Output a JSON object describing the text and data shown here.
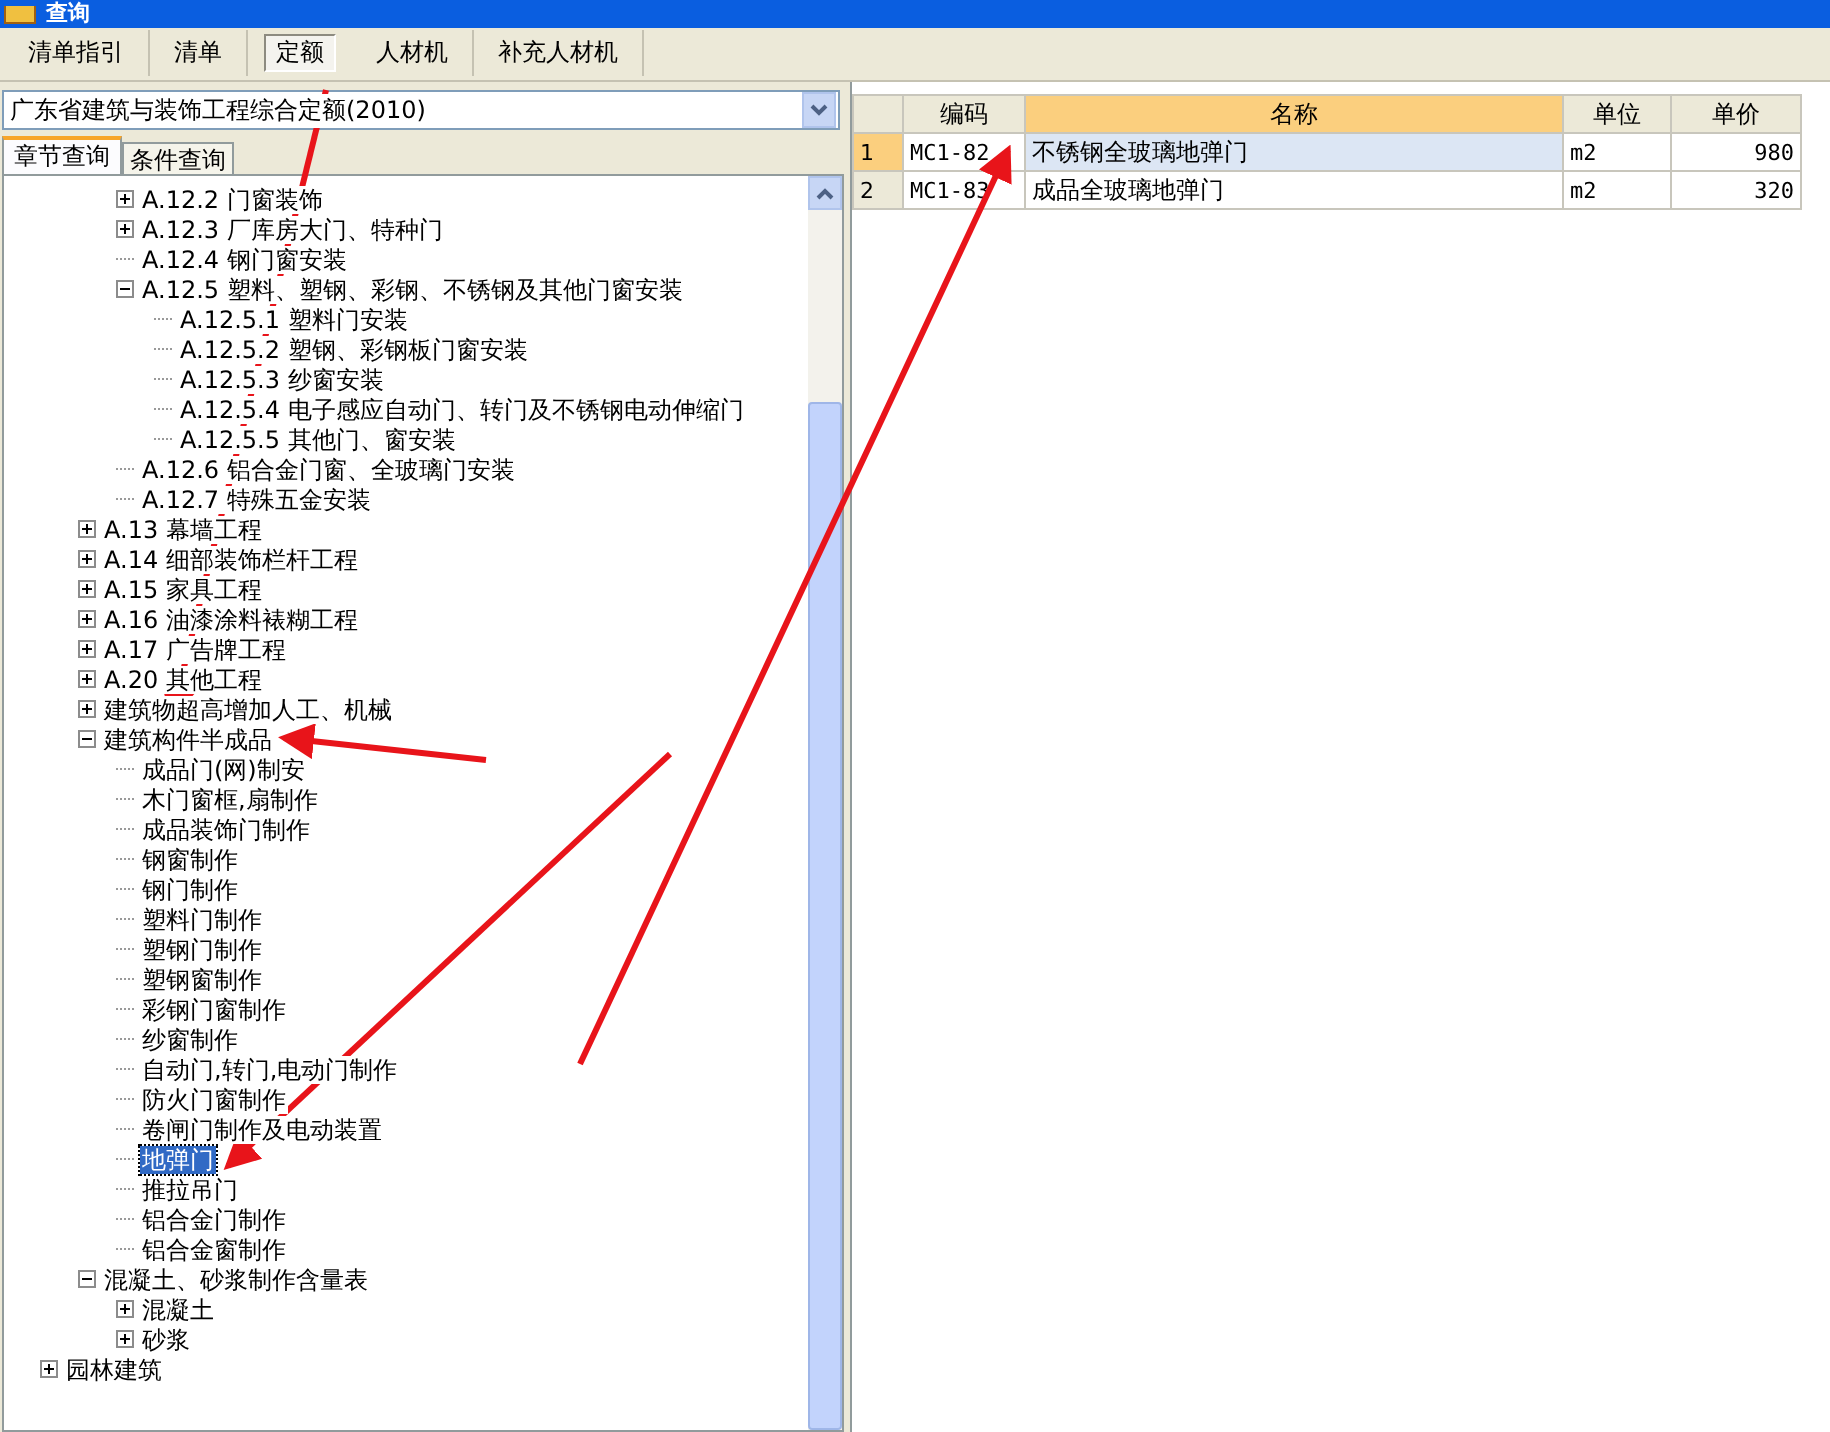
{
  "window": {
    "title": "查询"
  },
  "tabs": [
    {
      "label": "清单指引",
      "selected": false
    },
    {
      "label": "清单",
      "selected": false
    },
    {
      "label": "定额",
      "selected": true
    },
    {
      "label": "人材机",
      "selected": false
    },
    {
      "label": "补充人材机",
      "selected": false
    }
  ],
  "quota_select": {
    "value": "广东省建筑与装饰工程综合定额(2010)"
  },
  "search_tabs": [
    {
      "label": "章节查询",
      "selected": true
    },
    {
      "label": "条件查询",
      "selected": false
    }
  ],
  "tree": {
    "items": [
      {
        "children": [
          {
            "children": [
              {
                "label": "A.12.2 门窗装饰",
                "expanded": false,
                "selected": false
              },
              {
                "label": "A.12.3 厂库房大门、特种门",
                "expanded": false,
                "selected": false
              },
              {
                "label": "A.12.4 钢门窗安装",
                "selected": false
              },
              {
                "label": "A.12.5 塑料、塑钢、彩钢、不锈钢及其他门窗安装",
                "expanded": true,
                "selected": false,
                "children": [
                  {
                    "label": "A.12.5.1 塑料门安装",
                    "selected": false
                  },
                  {
                    "label": "A.12.5.2 塑钢、彩钢板门窗安装",
                    "selected": false
                  },
                  {
                    "label": "A.12.5.3 纱窗安装",
                    "selected": false
                  },
                  {
                    "label": "A.12.5.4 电子感应自动门、转门及不锈钢电动伸缩门",
                    "selected": false
                  },
                  {
                    "label": "A.12.5.5 其他门、窗安装",
                    "selected": false
                  }
                ]
              },
              {
                "label": "A.12.6 铝合金门窗、全玻璃门安装",
                "selected": false
              },
              {
                "label": "A.12.7 特殊五金安装",
                "selected": false
              }
            ]
          },
          {
            "label": "A.13 幕墙工程",
            "expanded": false,
            "selected": false
          },
          {
            "label": "A.14 细部装饰栏杆工程",
            "expanded": false,
            "selected": false
          },
          {
            "label": "A.15 家具工程",
            "expanded": false,
            "selected": false
          },
          {
            "label": "A.16 油漆涂料裱糊工程",
            "expanded": false,
            "selected": false
          },
          {
            "label": "A.17 广告牌工程",
            "expanded": false,
            "selected": false
          },
          {
            "label": "A.20 其他工程",
            "expanded": false,
            "selected": false
          },
          {
            "label": "建筑物超高增加人工、机械",
            "expanded": false,
            "selected": false
          },
          {
            "label": "建筑构件半成品",
            "expanded": true,
            "selected": false,
            "children": [
              {
                "label": "成品门(网)制安",
                "selected": false
              },
              {
                "label": "木门窗框,扇制作",
                "selected": false
              },
              {
                "label": "成品装饰门制作",
                "selected": false
              },
              {
                "label": "钢窗制作",
                "selected": false
              },
              {
                "label": "钢门制作",
                "selected": false
              },
              {
                "label": "塑料门制作",
                "selected": false
              },
              {
                "label": "塑钢门制作",
                "selected": false
              },
              {
                "label": "塑钢窗制作",
                "selected": false
              },
              {
                "label": "彩钢门窗制作",
                "selected": false
              },
              {
                "label": "纱窗制作",
                "selected": false
              },
              {
                "label": "自动门,转门,电动门制作",
                "selected": false
              },
              {
                "label": "防火门窗制作",
                "selected": false
              },
              {
                "label": "卷闸门制作及电动装置",
                "selected": false
              },
              {
                "label": "地弹门",
                "selected": true
              },
              {
                "label": "推拉吊门",
                "selected": false
              },
              {
                "label": "铝合金门制作",
                "selected": false
              },
              {
                "label": "铝合金窗制作",
                "selected": false
              }
            ]
          },
          {
            "label": "混凝土、砂浆制作含量表",
            "expanded": true,
            "selected": false,
            "children": [
              {
                "label": "混凝土",
                "expanded": false,
                "selected": false
              },
              {
                "label": "砂浆",
                "expanded": false,
                "selected": false
              }
            ]
          }
        ]
      },
      {
        "label": "园林建筑",
        "expanded": false,
        "selected": false
      }
    ]
  },
  "table": {
    "columns": [
      {
        "label": "编码",
        "selected": false
      },
      {
        "label": "名称",
        "selected": true
      },
      {
        "label": "单位",
        "selected": false
      },
      {
        "label": "单价",
        "selected": false
      }
    ],
    "rows": [
      {
        "number": "1",
        "selected": true,
        "cells": [
          "MC1-82",
          "不锈钢全玻璃地弹门",
          "m2",
          "980"
        ]
      },
      {
        "number": "2",
        "selected": false,
        "cells": [
          "MC1-83",
          "成品全玻璃地弹门",
          "m2",
          "320"
        ]
      }
    ]
  }
}
